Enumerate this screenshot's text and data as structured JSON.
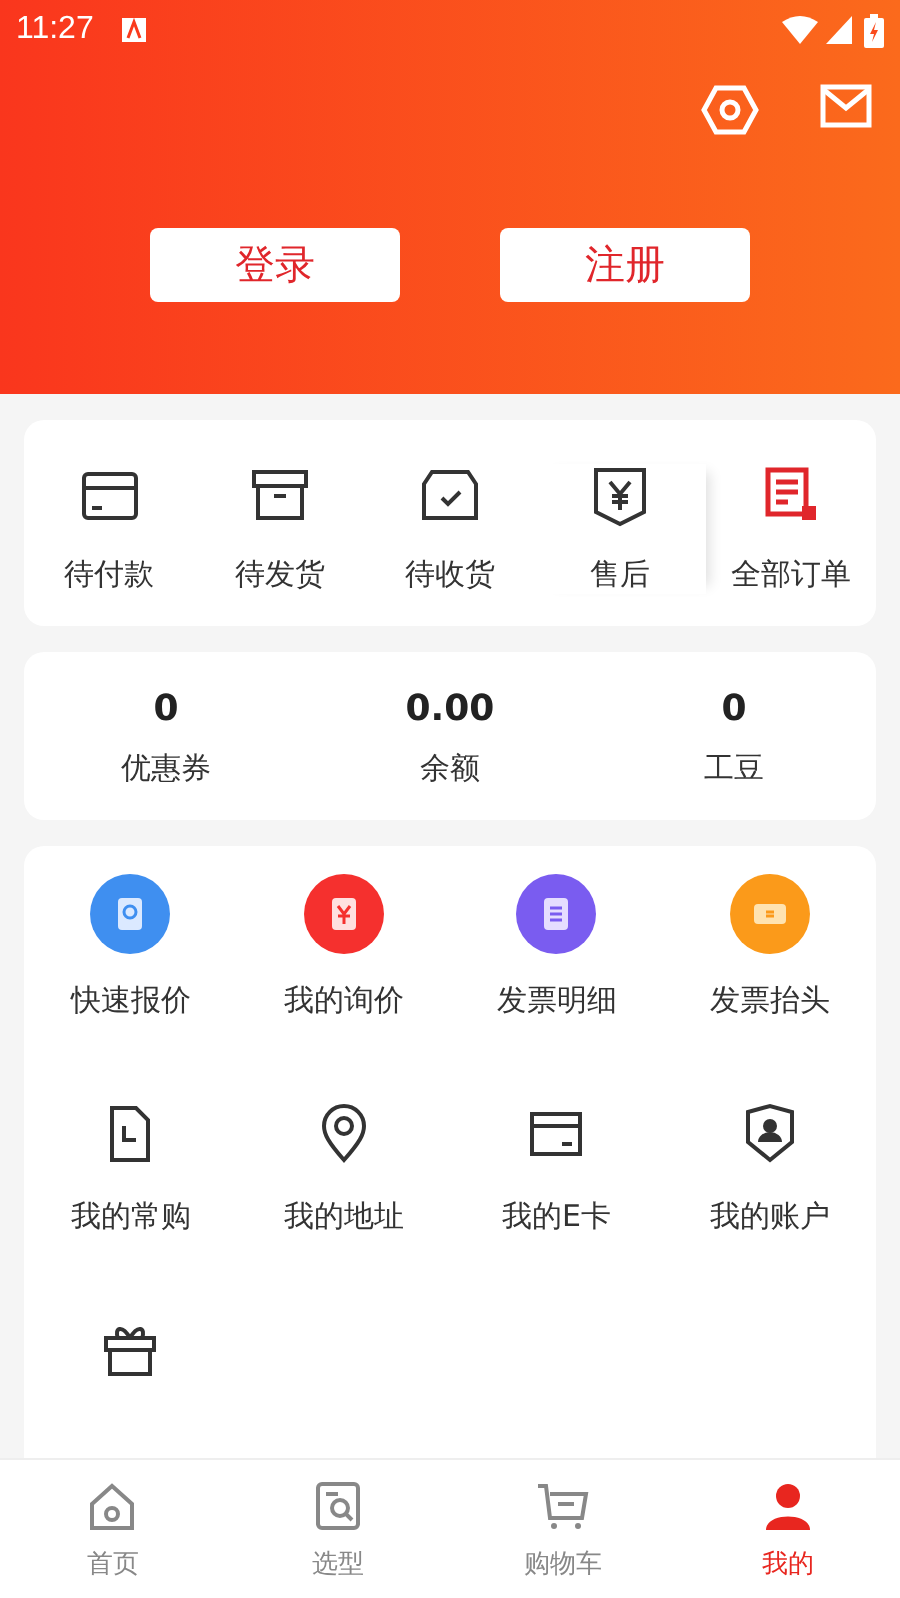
{
  "status_bar": {
    "time": "11:27"
  },
  "header": {
    "buttons": [
      "登录",
      "注册"
    ]
  },
  "orders": [
    {
      "label": "待付款"
    },
    {
      "label": "待发货"
    },
    {
      "label": "待收货"
    },
    {
      "label": "售后"
    },
    {
      "label": "全部订单"
    }
  ],
  "assets": [
    {
      "value": "0",
      "label": "优惠券"
    },
    {
      "value": "0.00",
      "label": "余额"
    },
    {
      "value": "0",
      "label": "工豆"
    }
  ],
  "services": [
    {
      "kind": "badge",
      "label": "快速报价",
      "color": "#3f8ff0"
    },
    {
      "kind": "badge",
      "label": "我的询价",
      "color": "#f5302e"
    },
    {
      "kind": "badge",
      "label": "发票明细",
      "color": "#7a5cf0"
    },
    {
      "kind": "badge",
      "label": "发票抬头",
      "color": "#fb9a1a"
    },
    {
      "kind": "line",
      "label": "我的常购"
    },
    {
      "kind": "line",
      "label": "我的地址"
    },
    {
      "kind": "line",
      "label": "我的E卡"
    },
    {
      "kind": "line",
      "label": "我的账户"
    },
    {
      "kind": "line"
    }
  ],
  "tab_bar": [
    {
      "label": "首页",
      "selected": false
    },
    {
      "label": "选型",
      "selected": false
    },
    {
      "label": "购物车",
      "selected": false
    },
    {
      "label": "我的",
      "selected": true
    }
  ]
}
